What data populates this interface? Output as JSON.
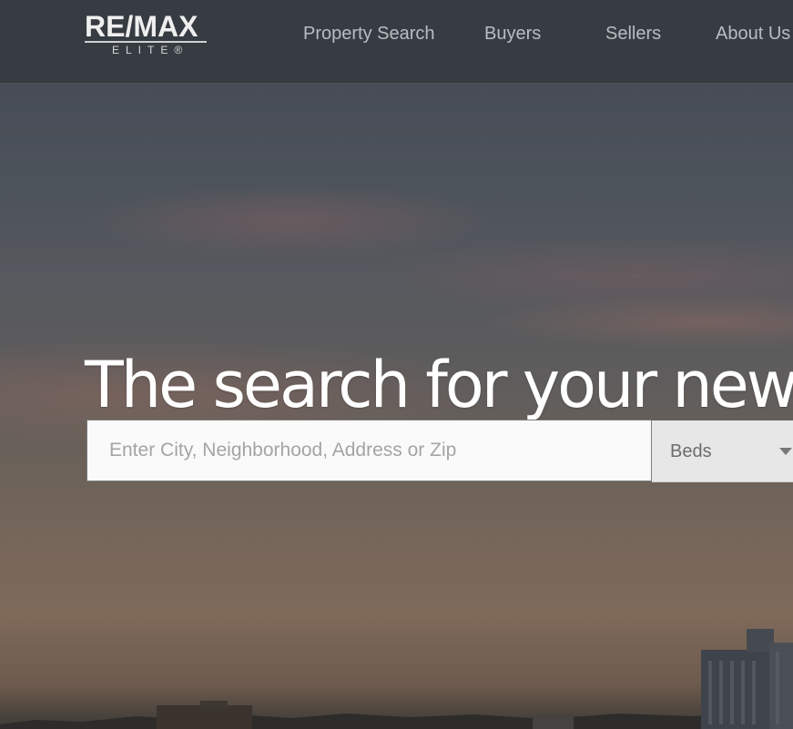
{
  "brand": {
    "logo_main": "RE/MAX",
    "logo_sub": "ELITE®"
  },
  "nav": {
    "items": [
      {
        "label": "Property Search"
      },
      {
        "label": "Buyers"
      },
      {
        "label": "Sellers"
      },
      {
        "label": "About Us"
      }
    ]
  },
  "hero": {
    "headline": "The search for your new"
  },
  "search": {
    "placeholder": "Enter City, Neighborhood, Address or Zip",
    "value": "",
    "beds_label": "Beds"
  },
  "colors": {
    "header_bg": "#373c43",
    "nav_text": "#b9bcc1",
    "headline": "#ffffff"
  },
  "icons": {
    "beds_caret": "chevron-down-icon"
  }
}
